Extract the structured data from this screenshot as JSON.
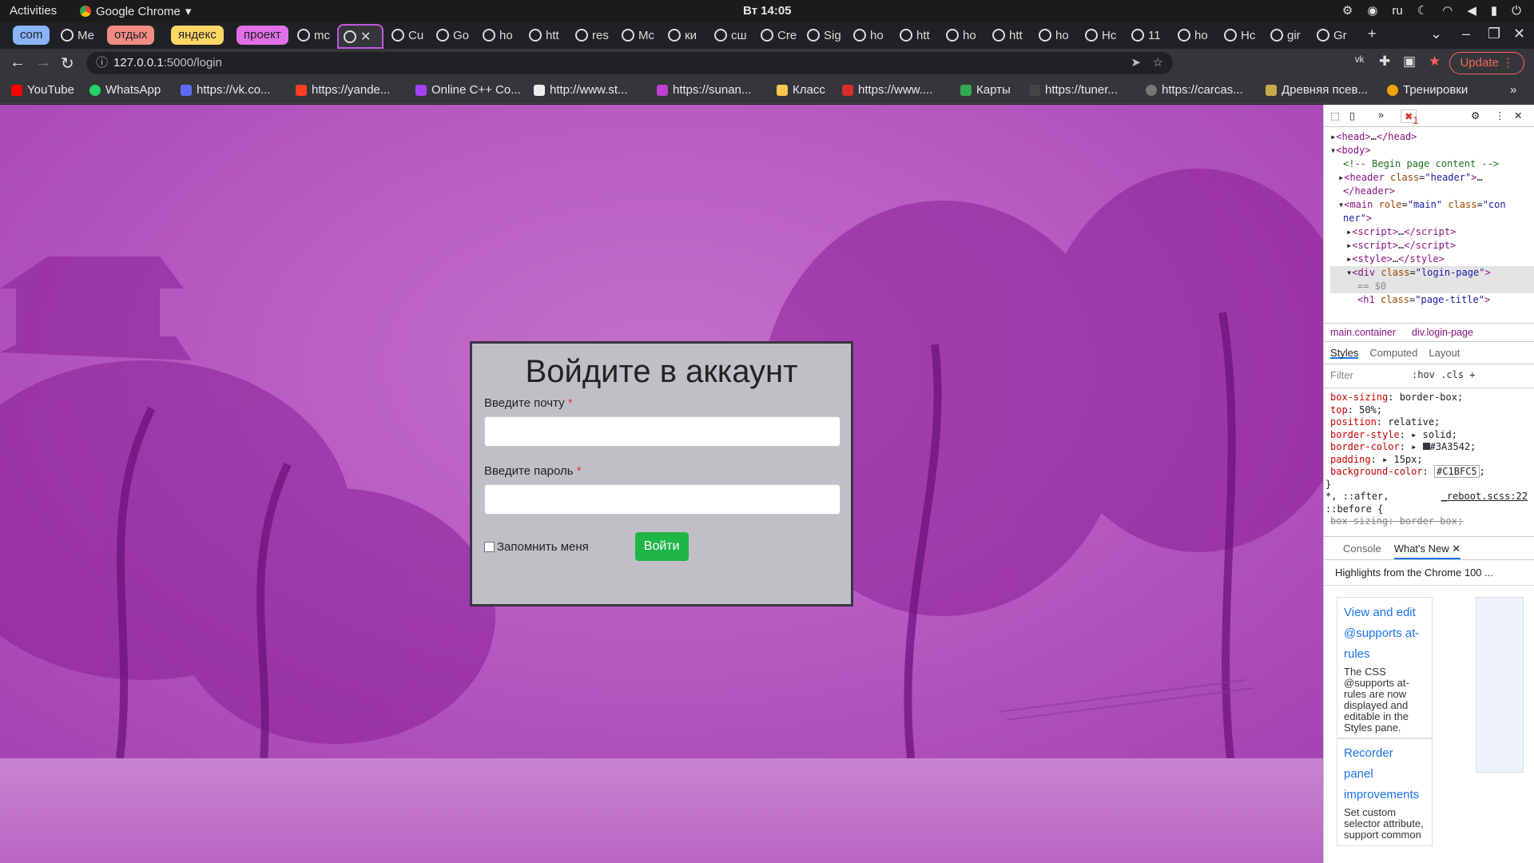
{
  "system_bar": {
    "activities": "Activities",
    "app": "Google Chrome",
    "clock": "Вт 14:05",
    "lang": "ru"
  },
  "tabs": {
    "groups": [
      {
        "label": "com",
        "color": "#8ab4f8"
      },
      {
        "label": "отдых",
        "color": "#f28b82"
      },
      {
        "label": "яндекс",
        "color": "#fdd663"
      },
      {
        "label": "проект",
        "color": "#e070e8"
      }
    ],
    "items": [
      "Ме",
      "mc",
      "Cu",
      "Go",
      "ho",
      "htt",
      "res",
      "Mc",
      "ки",
      "сш",
      "Cre",
      "Sig",
      "ho",
      "htt",
      "ho",
      "htt",
      "ho",
      "Hc",
      "11",
      "ho",
      "Hc",
      "gir",
      "Gr"
    ]
  },
  "toolbar": {
    "url_host": "127.0.0.1",
    "url_rest": ":5000/login",
    "update_label": "Update"
  },
  "bookmarks": [
    {
      "label": "YouTube",
      "color": "#ff0000"
    },
    {
      "label": "WhatsApp",
      "color": "#25d366"
    },
    {
      "label": "https://vk.co...",
      "color": "#5c6bf5"
    },
    {
      "label": "https://yande...",
      "color": "#fc3f1d"
    },
    {
      "label": "Online C++ Co...",
      "color": "#a142f4"
    },
    {
      "label": "http://www.st...",
      "color": "#eeeeee"
    },
    {
      "label": "https://sunan...",
      "color": "#c040d0"
    },
    {
      "label": "Класс",
      "color": "#f7c948"
    },
    {
      "label": "https://www....",
      "color": "#d32f2f"
    },
    {
      "label": "Карты",
      "color": "#34a853"
    },
    {
      "label": "https://tuner...",
      "color": "#444444"
    },
    {
      "label": "https://carcas...",
      "color": "#777777"
    },
    {
      "label": "Древняя псев...",
      "color": "#c9a94e"
    },
    {
      "label": "Тренировки",
      "color": "#f4a300"
    }
  ],
  "login": {
    "title": "Войдите в аккаунт",
    "email_label": "Введите почту",
    "password_label": "Введите пароль",
    "required_mark": "*",
    "remember_label": "Запомнить меня",
    "submit_label": "Войти"
  },
  "devtools": {
    "error_count": "1",
    "breadcrumbs": [
      "main.container",
      "div.login-page"
    ],
    "style_tabs": [
      "Styles",
      "Computed",
      "Layout"
    ],
    "filter_placeholder": "Filter",
    "hov": ":hov",
    "cls": ".cls",
    "reboot_source": "_reboot.scss:22",
    "drawer_tabs": [
      "Console",
      "What's New"
    ],
    "whats_new_title": "Highlights from the Chrome 100 ...",
    "cards": [
      {
        "heading": "View and edit @supports at-rules",
        "desc": "The CSS @supports at-rules are now displayed and editable in the Styles pane."
      },
      {
        "heading": "Recorder panel improvements",
        "desc": "Set custom selector attribute, support common"
      }
    ]
  }
}
